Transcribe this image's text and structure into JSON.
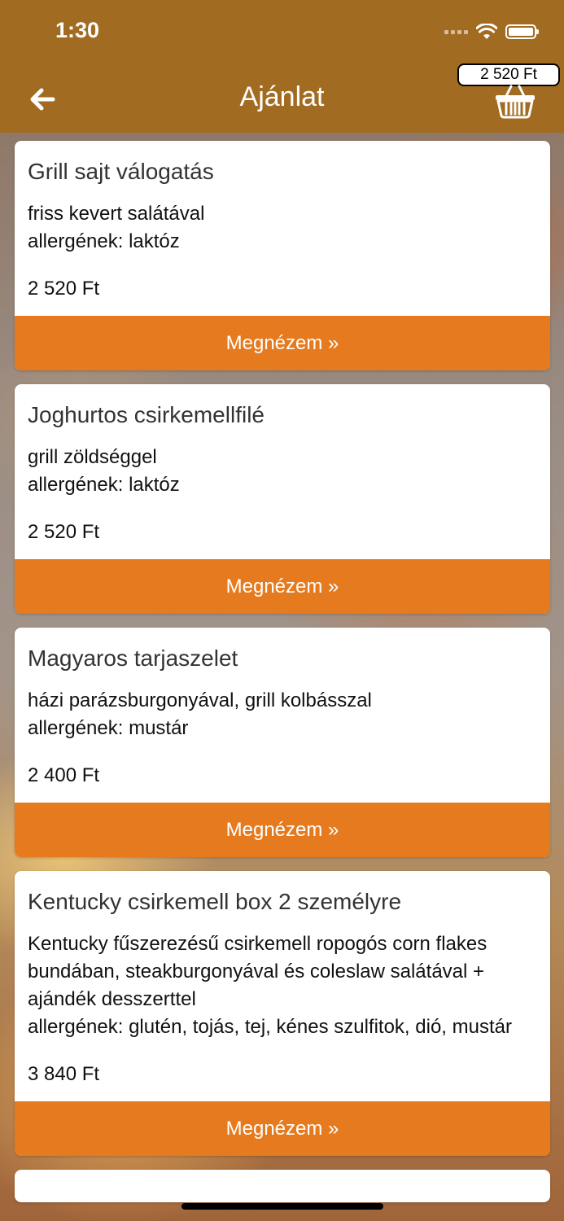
{
  "status_bar": {
    "time": "1:30"
  },
  "header": {
    "title": "Ajánlat",
    "cart_total": "2 520 Ft"
  },
  "colors": {
    "header": "#a26b22",
    "button": "#e57a1f"
  },
  "icons": {
    "back": "arrow-left-icon",
    "cart": "basket-icon",
    "wifi": "wifi-icon",
    "battery": "battery-icon"
  },
  "offers": [
    {
      "title": "Grill sajt válogatás",
      "description": "friss kevert salátával\nallergének: laktóz",
      "price": "2 520 Ft",
      "button": "Megnézem »"
    },
    {
      "title": "Joghurtos csirkemellfilé",
      "description": "grill zöldséggel\nallergének: laktóz",
      "price": "2 520 Ft",
      "button": "Megnézem »"
    },
    {
      "title": "Magyaros tarjaszelet",
      "description": "házi parázsburgonyával, grill kolbásszal\nallergének: mustár",
      "price": "2 400 Ft",
      "button": "Megnézem »"
    },
    {
      "title": "Kentucky csirkemell box 2 személyre",
      "description": "Kentucky fűszerezésű csirkemell ropogós corn flakes bundában, steakburgonyával és coleslaw salátával + ajándék desszerttel\nallergének: glutén, tojás, tej, kénes szulfitok, dió, mustár",
      "price": "3 840 Ft",
      "button": "Megnézem »"
    }
  ]
}
